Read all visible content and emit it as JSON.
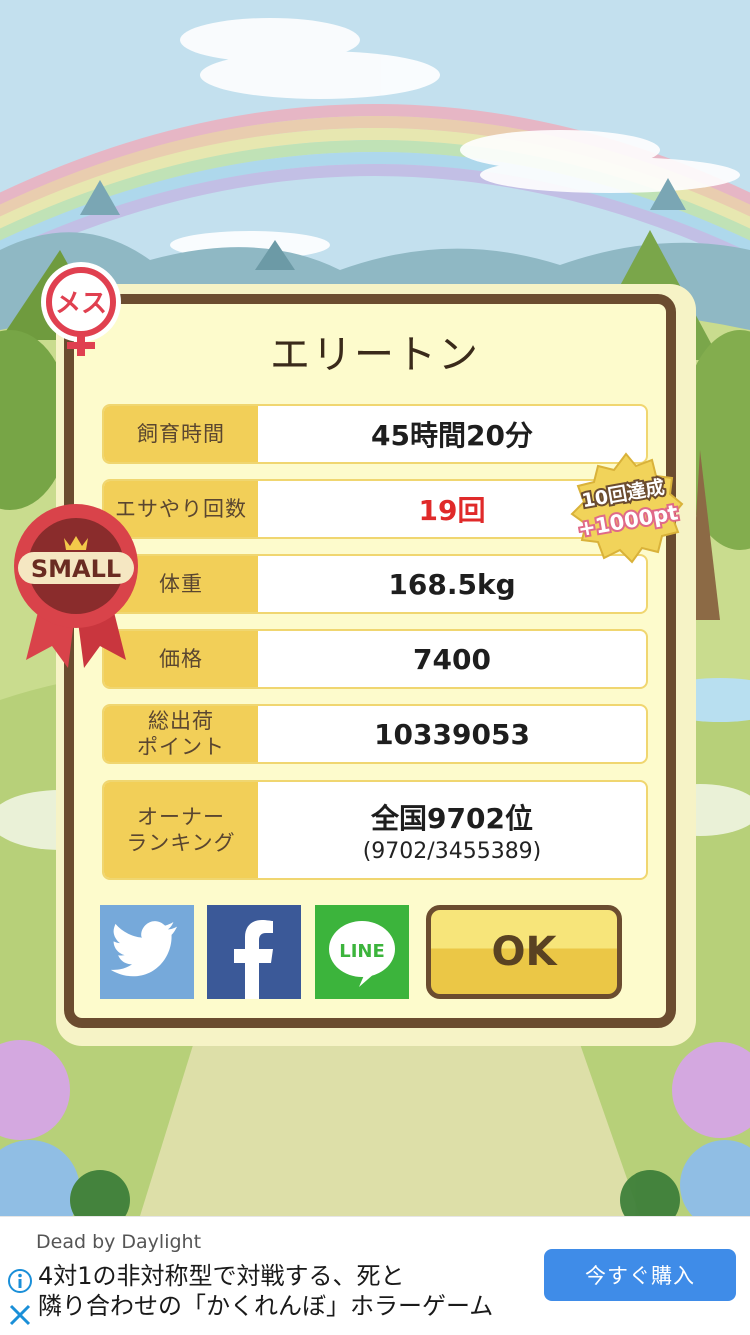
{
  "pet": {
    "name": "エリートン",
    "gender_badge": "メス",
    "size_badge": "SMALL"
  },
  "stats": [
    {
      "label": "飼育時間",
      "value": "45時間20分"
    },
    {
      "label": "エサやり回数",
      "value": "19回",
      "highlight": "#e02a2a"
    },
    {
      "label": "体重",
      "value": "168.5kg"
    },
    {
      "label": "価格",
      "value": "7400"
    },
    {
      "label": "総出荷\nポイント",
      "value": "10339053"
    },
    {
      "label": "オーナー\nランキング",
      "value": "全国9702位",
      "sub": "(9702/3455389)"
    }
  ],
  "bonus_badge": {
    "line1": "10回達成",
    "line2": "+1000pt"
  },
  "share": {
    "twitter_icon": "twitter-bird-icon",
    "facebook_icon": "facebook-f-icon",
    "line_label": "LINE"
  },
  "ok_label": "OK",
  "ad": {
    "advertiser": "Dead by Daylight",
    "line1": "4対1の非対称型で対戦する、死と",
    "line2": "隣り合わせの「かくれんぼ」ホラーゲーム",
    "cta": "今すぐ購入"
  },
  "colors": {
    "label_bg": "#f2cf58",
    "frame": "#6b4c2f",
    "twitter": "#76a9da",
    "facebook": "#3b5998",
    "line": "#3cb43c",
    "cta": "#3f8ce8"
  }
}
